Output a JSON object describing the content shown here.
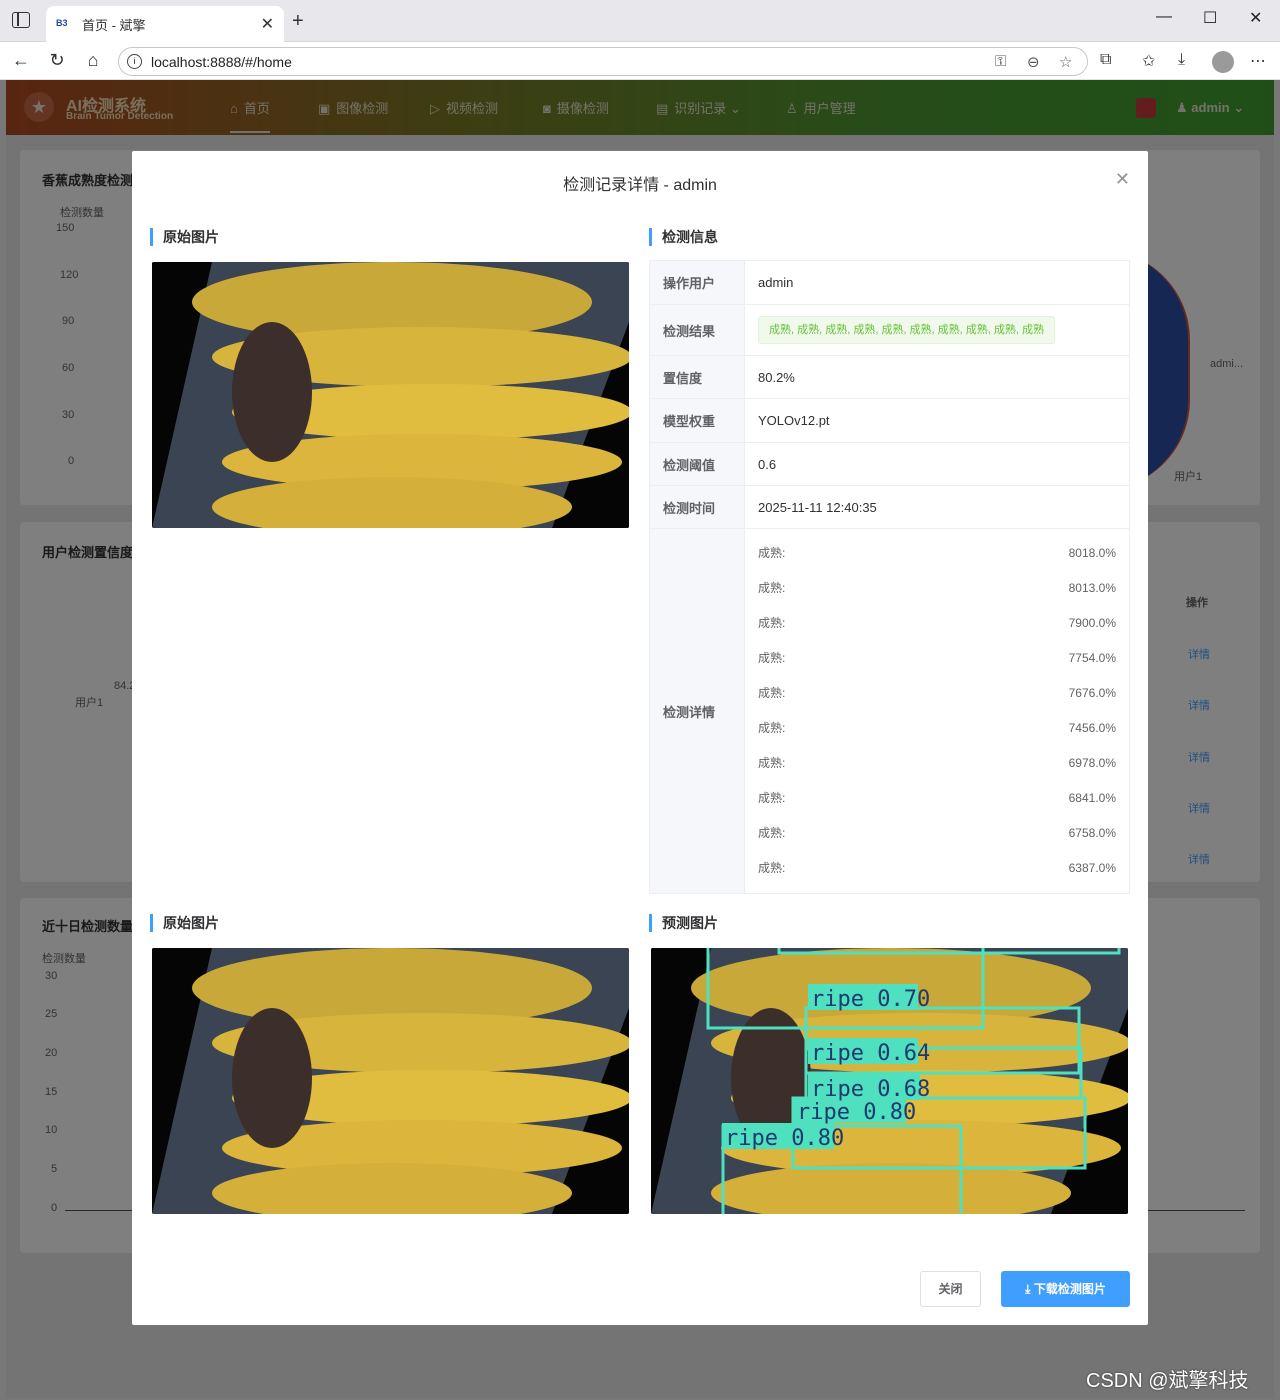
{
  "browser": {
    "tab_title": "首页 - 斌擎",
    "favicon_text": "B3",
    "url": "localhost:8888/#/home"
  },
  "app": {
    "brand": "AI检测系统",
    "brand_sub": "Brain Tumor Detection",
    "nav": [
      {
        "label": "首页",
        "icon": "home-icon"
      },
      {
        "label": "图像检测",
        "icon": "image-icon"
      },
      {
        "label": "视频检测",
        "icon": "play-icon"
      },
      {
        "label": "摄像检测",
        "icon": "camera-icon"
      },
      {
        "label": "识别记录",
        "icon": "document-icon"
      },
      {
        "label": "用户管理",
        "icon": "user-icon"
      }
    ],
    "user": "admin"
  },
  "background": {
    "card1_title": "香蕉成熟度检测",
    "card1_ylabel": "检测数量",
    "card1_ticks": [
      "150",
      "120",
      "90",
      "60",
      "30",
      "0"
    ],
    "pie_label": "admi...",
    "pie_legend": "用户1",
    "card2_title": "用户检测置信度",
    "card2_point_label": "84.2",
    "card2_user": "用户1",
    "table_op_header": "操作",
    "table_link": "详情",
    "card3_title": "近十日检测数量",
    "card3_ylabel": "检测数量",
    "card3_ticks": [
      "30",
      "25",
      "20",
      "15",
      "10",
      "5",
      "0"
    ]
  },
  "modal": {
    "title": "检测记录详情 - admin",
    "orig_title": "原始图片",
    "info_title": "检测信息",
    "orig_title2": "原始图片",
    "pred_title": "预测图片",
    "fields": {
      "user_k": "操作用户",
      "user_v": "admin",
      "result_k": "检测结果",
      "result_v": "成熟, 成熟, 成熟, 成熟, 成熟, 成熟, 成熟, 成熟, 成熟, 成熟",
      "conf_k": "置信度",
      "conf_v": "80.2%",
      "model_k": "模型权重",
      "model_v": "YOLOv12.pt",
      "thr_k": "检测阈值",
      "thr_v": "0.6",
      "time_k": "检测时间",
      "time_v": "2025-11-11 12:40:35",
      "detail_k": "检测详情"
    },
    "details": [
      {
        "label": "成熟:",
        "value": "8018.0%"
      },
      {
        "label": "成熟:",
        "value": "8013.0%"
      },
      {
        "label": "成熟:",
        "value": "7900.0%"
      },
      {
        "label": "成熟:",
        "value": "7754.0%"
      },
      {
        "label": "成熟:",
        "value": "7676.0%"
      },
      {
        "label": "成熟:",
        "value": "7456.0%"
      },
      {
        "label": "成熟:",
        "value": "6978.0%"
      },
      {
        "label": "成熟:",
        "value": "6841.0%"
      },
      {
        "label": "成熟:",
        "value": "6758.0%"
      },
      {
        "label": "成熟:",
        "value": "6387.0%"
      }
    ],
    "pred_labels": [
      "ripe 0.70",
      "ripe 0.64",
      "ripe 0.68",
      "ripe 0.80",
      "ripe 0.80"
    ],
    "close_btn": "关闭",
    "download_btn": "下载检测图片"
  },
  "watermark": "CSDN @斌擎科技"
}
